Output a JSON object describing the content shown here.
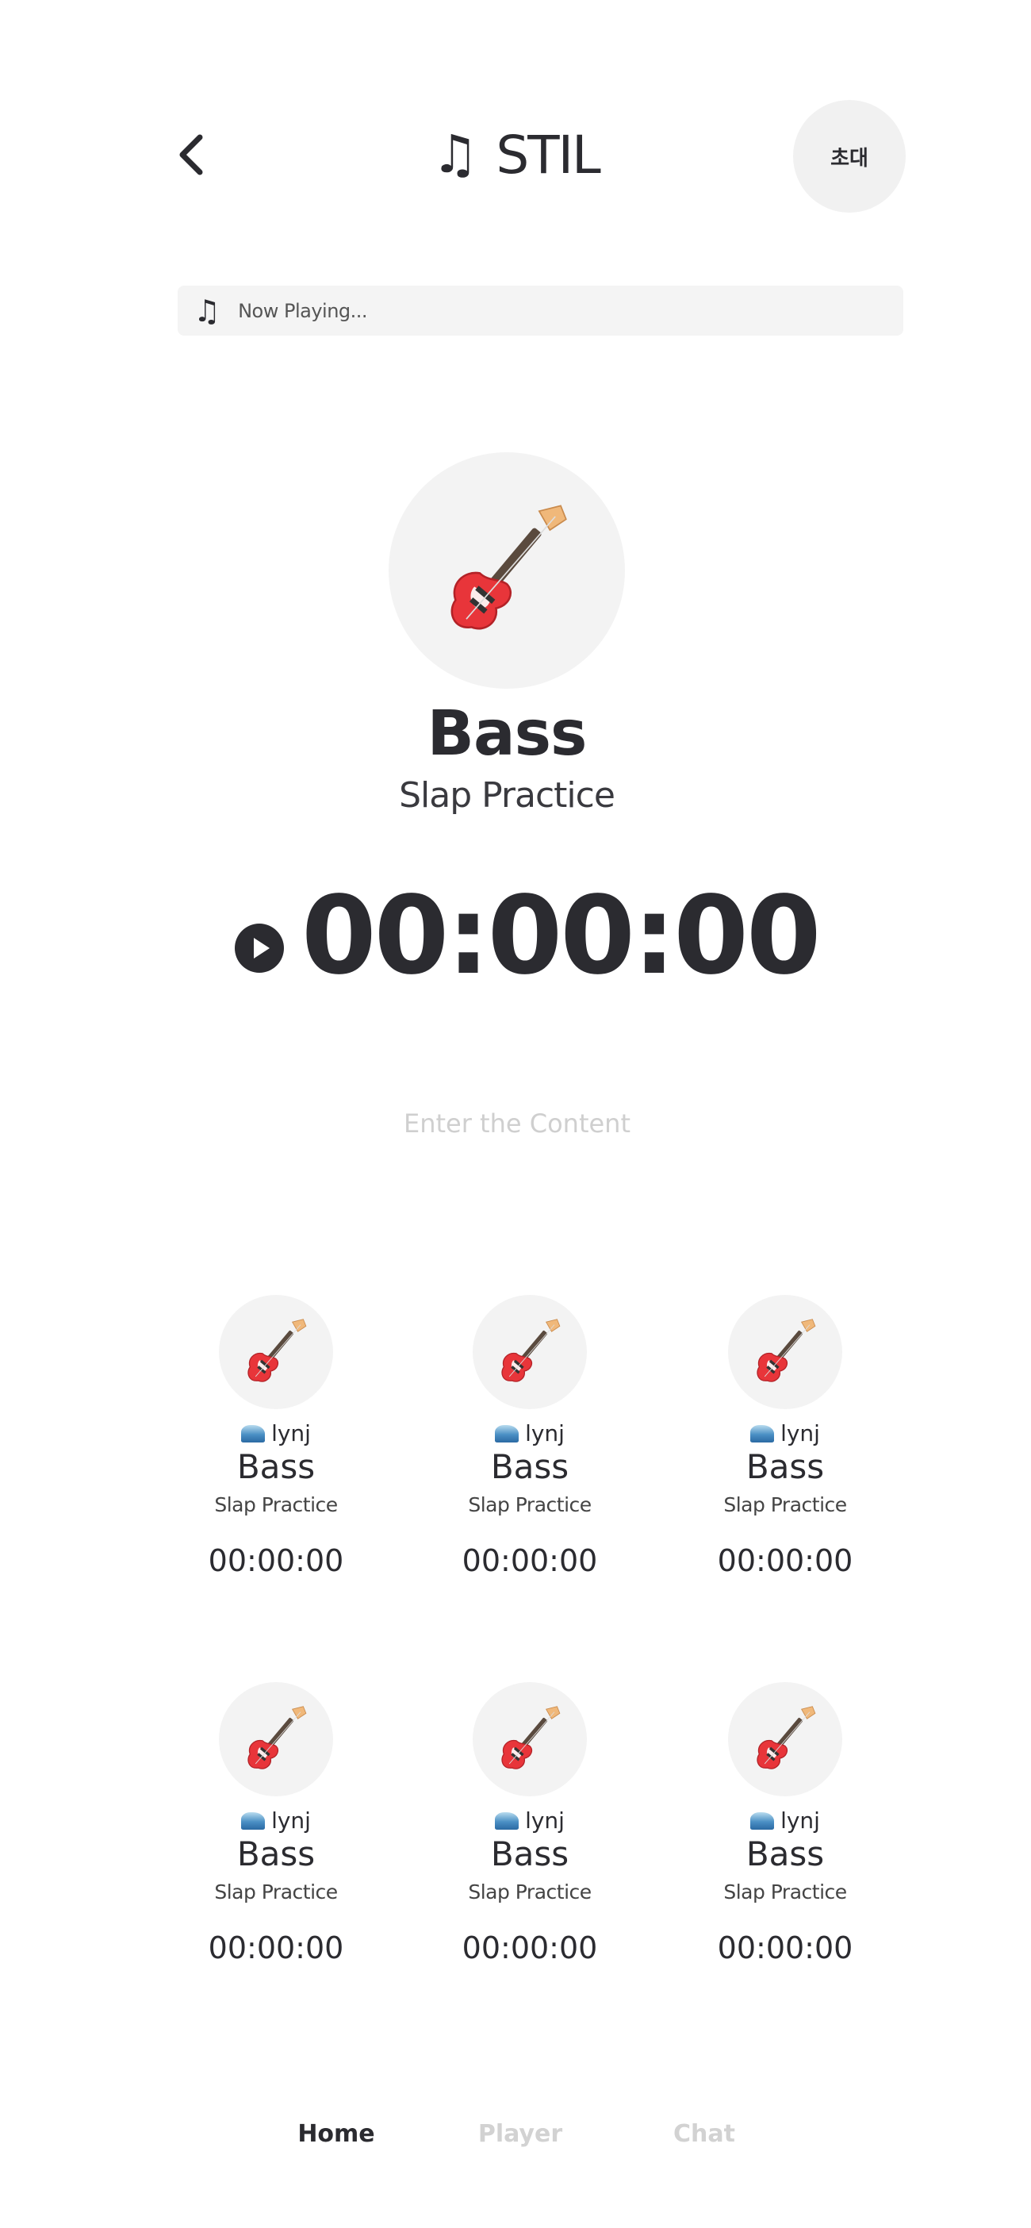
{
  "header": {
    "title": "STIL",
    "title_icon": "music-note-icon",
    "back_icon": "chevron-left-icon",
    "invite_label": "초대"
  },
  "now_playing": {
    "icon": "music-note-icon",
    "text": "Now Playing..."
  },
  "hero": {
    "icon": "guitar-icon",
    "instrument": "Bass",
    "activity": "Slap Practice",
    "timer": "00:00:00",
    "play_icon": "play-circle-icon"
  },
  "content_input": {
    "placeholder": "Enter the Content",
    "value": ""
  },
  "cards": [
    {
      "user_icon": "wave-icon",
      "user": "lynj",
      "instrument": "Bass",
      "activity": "Slap Practice",
      "timer": "00:00:00"
    },
    {
      "user_icon": "wave-icon",
      "user": "lynj",
      "instrument": "Bass",
      "activity": "Slap Practice",
      "timer": "00:00:00"
    },
    {
      "user_icon": "wave-icon",
      "user": "lynj",
      "instrument": "Bass",
      "activity": "Slap Practice",
      "timer": "00:00:00"
    },
    {
      "user_icon": "wave-icon",
      "user": "lynj",
      "instrument": "Bass",
      "activity": "Slap Practice",
      "timer": "00:00:00"
    },
    {
      "user_icon": "wave-icon",
      "user": "lynj",
      "instrument": "Bass",
      "activity": "Slap Practice",
      "timer": "00:00:00"
    },
    {
      "user_icon": "wave-icon",
      "user": "lynj",
      "instrument": "Bass",
      "activity": "Slap Practice",
      "timer": "00:00:00"
    }
  ],
  "nav": {
    "items": [
      {
        "label": "Home",
        "active": true
      },
      {
        "label": "Player",
        "active": false
      },
      {
        "label": "Chat",
        "active": false
      }
    ]
  },
  "colors": {
    "text_primary": "#2b2b30",
    "avatar_bg": "#f3f3f3",
    "nav_inactive": "#d2d2d2",
    "placeholder": "#cfcfcf",
    "guitar_body": "#e8353a"
  }
}
